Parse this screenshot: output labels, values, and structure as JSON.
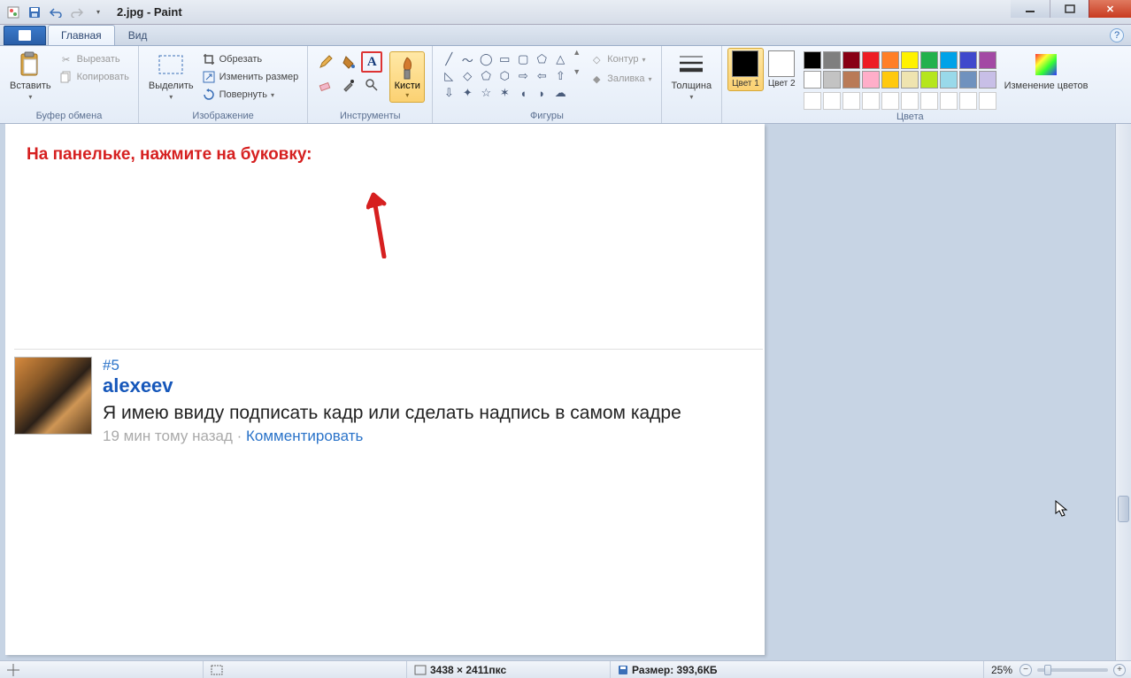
{
  "title": "2.jpg - Paint",
  "tabs": {
    "main": "Главная",
    "view": "Вид"
  },
  "clipboard": {
    "paste": "Вставить",
    "cut": "Вырезать",
    "copy": "Копировать",
    "group_label": "Буфер обмена"
  },
  "image": {
    "select": "Выделить",
    "crop": "Обрезать",
    "resize": "Изменить размер",
    "rotate": "Повернуть",
    "group_label": "Изображение"
  },
  "tools": {
    "group_label": "Инструменты"
  },
  "brushes": {
    "label": "Кисти"
  },
  "shapes": {
    "outline": "Контур",
    "fill": "Заливка",
    "group_label": "Фигуры"
  },
  "size": {
    "label": "Толщина"
  },
  "colors": {
    "c1": "Цвет 1",
    "c2": "Цвет 2",
    "edit": "Изменение цветов",
    "group_label": "Цвета",
    "palette_row1": [
      "#000000",
      "#7f7f7f",
      "#880015",
      "#ed1c24",
      "#ff7f27",
      "#fff200",
      "#22b14c",
      "#00a2e8",
      "#3f48cc",
      "#a349a4"
    ],
    "palette_row2": [
      "#ffffff",
      "#c3c3c3",
      "#b97a57",
      "#ffaec9",
      "#ffc90e",
      "#efe4b0",
      "#b5e61d",
      "#99d9ea",
      "#7092be",
      "#c8bfe7"
    ]
  },
  "canvas": {
    "instruction": "На панельке, нажмите на буковку:",
    "post_num": "#5",
    "post_user": "alexeev",
    "post_text": "Я имею ввиду подписать кадр или сделать надпись в самом кадре",
    "post_time": "19 мин тому назад",
    "post_comment": "Комментировать"
  },
  "status": {
    "dimensions": "3438 × 2411пкс",
    "size_label": "Размер: 393,6КБ",
    "zoom": "25%"
  }
}
